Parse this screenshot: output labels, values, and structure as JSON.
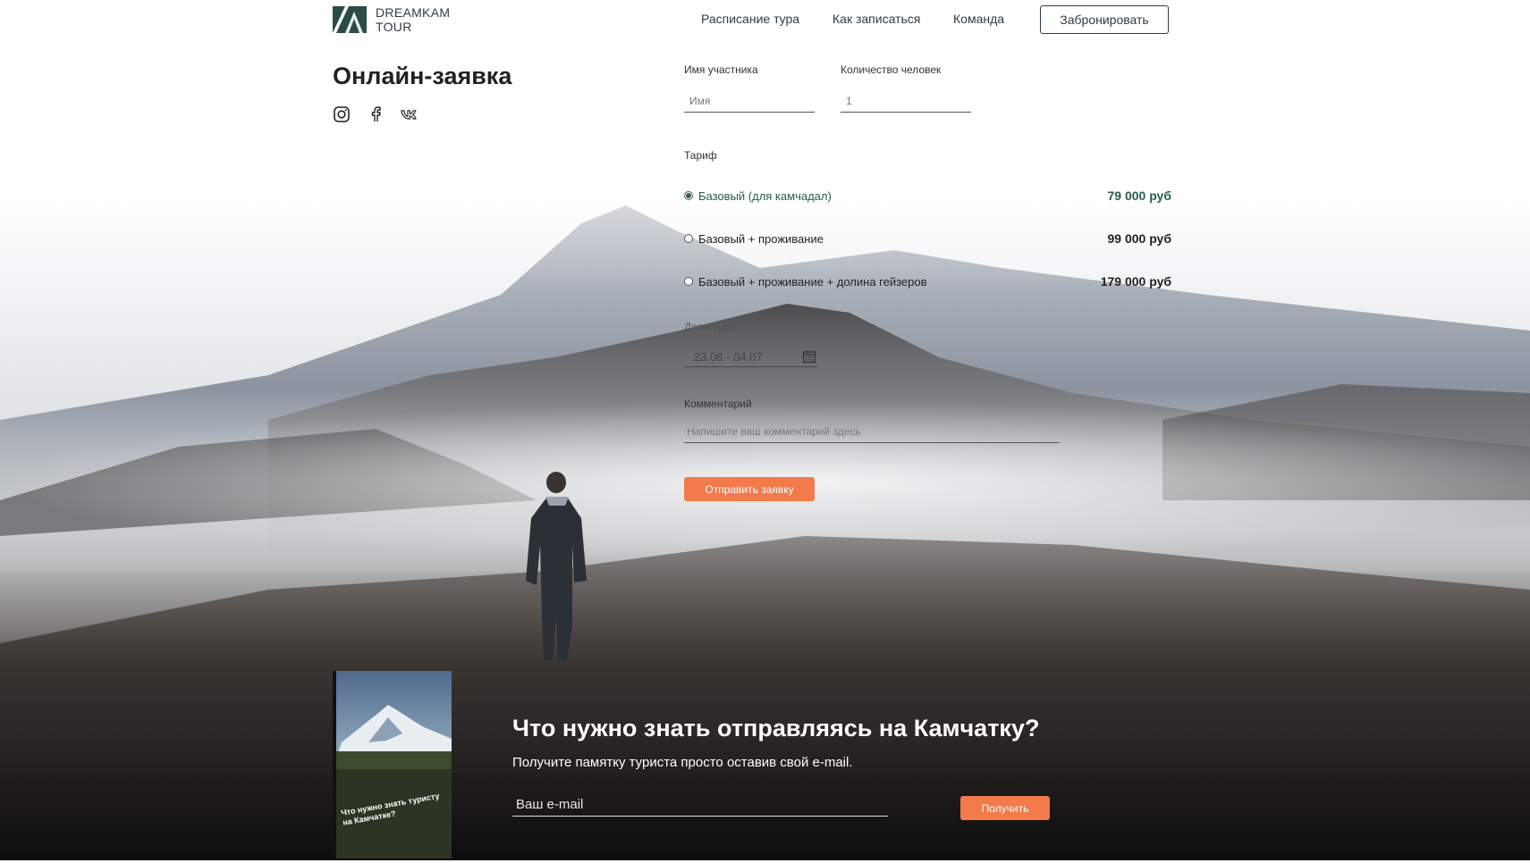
{
  "brand": {
    "line1": "DREAMKAM",
    "line2": "TOUR",
    "logo_icon": "mountain-logo-icon"
  },
  "nav": {
    "items": [
      {
        "label": "Расписание тура"
      },
      {
        "label": "Как записаться"
      },
      {
        "label": "Команда"
      }
    ],
    "book_label": "Забронировать"
  },
  "page": {
    "title": "Онлайн-заявка"
  },
  "socials": {
    "icons": [
      "instagram-icon",
      "facebook-icon",
      "vk-icon"
    ]
  },
  "form": {
    "name_label": "Имя участника",
    "name_placeholder": "Имя",
    "count_label": "Количество человек",
    "count_placeholder": "1",
    "tariff_label": "Тариф",
    "tariffs": [
      {
        "name": "Базовый (для камчадал)",
        "price": "79 000 руб",
        "selected": true
      },
      {
        "name": "Базовый + проживание",
        "price": "99 000 руб",
        "selected": false
      },
      {
        "name": "Базовый + проживание + долина гейзеров",
        "price": "179 000 руб",
        "selected": false
      }
    ],
    "dates_label": "Даты тура",
    "dates_value": "23.06 - 04.07",
    "comment_label": "Комментарий",
    "comment_placeholder": "Напишите ваш комментарий здесь",
    "submit_label": "Отправить заявку"
  },
  "promo": {
    "book_title": "Что нужно знать туристу на Камчатке?",
    "title": "Что нужно знать отправляясь на Камчатку?",
    "subtitle": "Получите памятку туриста просто оставив свой e-mail.",
    "email_placeholder": "Ваш e-mail",
    "button_label": "Получить"
  },
  "colors": {
    "accent": "#f27a4b",
    "brand_dark": "#2d3b45",
    "selected_tariff": "#2b5c52"
  }
}
